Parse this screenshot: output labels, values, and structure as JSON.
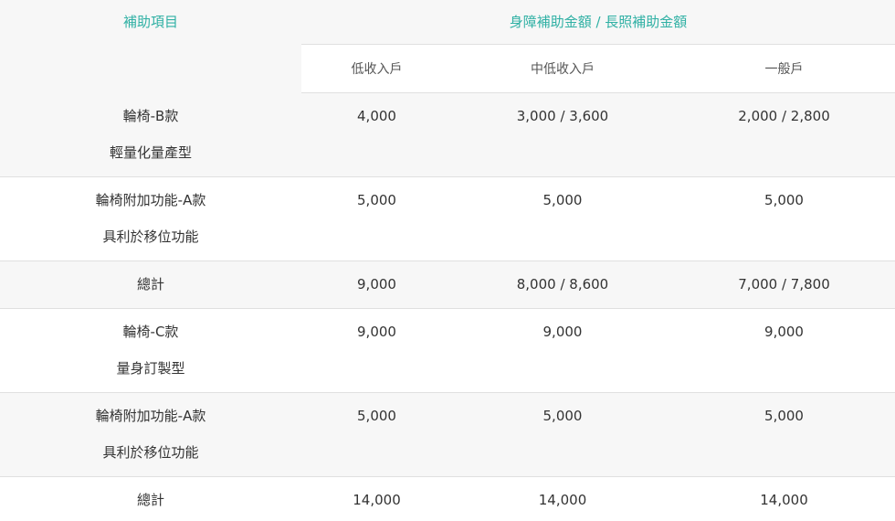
{
  "header": {
    "item_title": "補助項目",
    "amount_title": "身障補助金額 / 長照補助金額",
    "columns": [
      "低收入戶",
      "中低收入戶",
      "一般戶"
    ]
  },
  "rows": [
    {
      "item": "輪椅-B款",
      "sub": "輕量化量產型",
      "low": "4,000",
      "mid": "3,000 / 3,600",
      "general": "2,000 / 2,800"
    },
    {
      "item": "輪椅附加功能-A款",
      "sub": "具利於移位功能",
      "low": "5,000",
      "mid": "5,000",
      "general": "5,000"
    },
    {
      "item": "總計",
      "sub": "",
      "low": "9,000",
      "mid": "8,000 / 8,600",
      "general": "7,000 / 7,800"
    },
    {
      "item": "輪椅-C款",
      "sub": "量身訂製型",
      "low": "9,000",
      "mid": "9,000",
      "general": "9,000"
    },
    {
      "item": "輪椅附加功能-A款",
      "sub": "具利於移位功能",
      "low": "5,000",
      "mid": "5,000",
      "general": "5,000"
    },
    {
      "item": "總計",
      "sub": "",
      "low": "14,000",
      "mid": "14,000",
      "general": "14,000"
    }
  ],
  "colors": {
    "accent": "#2fb0a4",
    "shade": "#f7f7f7",
    "border": "#e0e0e0"
  }
}
